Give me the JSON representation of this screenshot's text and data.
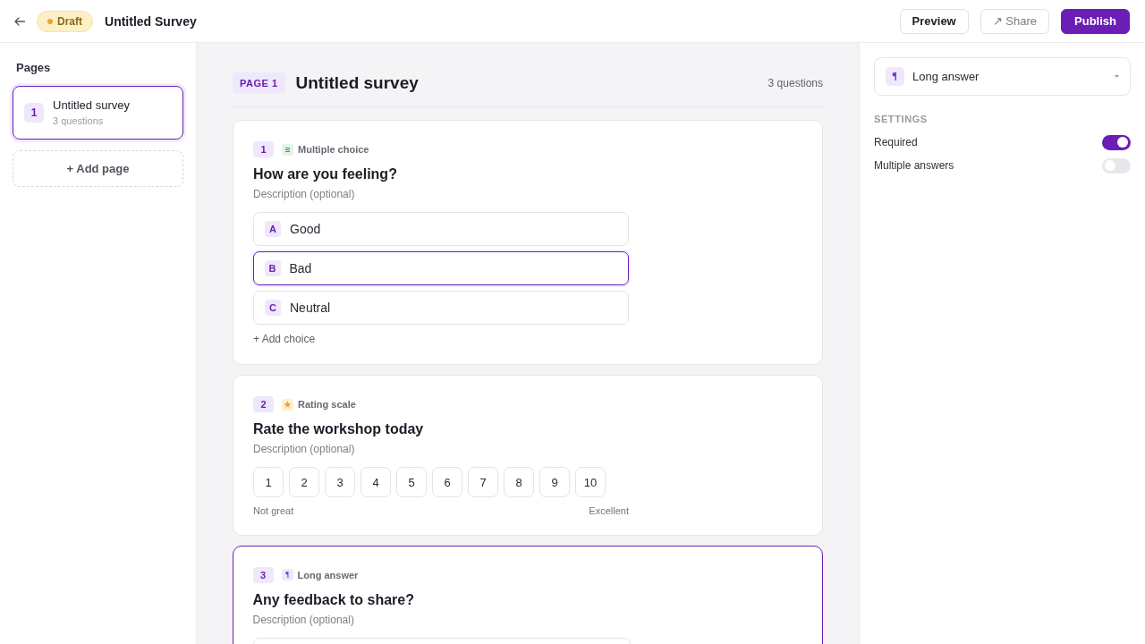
{
  "top_bar": {
    "status": "Draft",
    "title": "Untitled Survey",
    "buttons": [
      {
        "label": "Preview",
        "kind": "preview"
      },
      {
        "label": "↗ Share",
        "kind": "share"
      },
      {
        "label": "Publish",
        "kind": "publish"
      }
    ]
  },
  "sidebar": {
    "heading": "Pages",
    "pages": [
      {
        "number": "1",
        "title": "Untitled survey",
        "subtitle": "3 questions",
        "selected": true
      }
    ],
    "add_page": "+ Add page"
  },
  "editor": {
    "page_badge": "PAGE 1",
    "title": "Untitled survey",
    "question_count": "3 questions",
    "questions": [
      {
        "number": "1",
        "kind": "multiple_choice",
        "type_label": "Multiple choice",
        "title": "How are you feeling?",
        "description": {
          "placeholder": "Description (optional)"
        },
        "selected": false,
        "choices": [
          {
            "letter": "A",
            "label": "Good",
            "selected": false
          },
          {
            "letter": "B",
            "label": "Bad",
            "selected": true
          },
          {
            "letter": "C",
            "label": "Neutral",
            "selected": false
          }
        ],
        "add_choice": "+ Add choice"
      },
      {
        "number": "2",
        "kind": "rating",
        "type_label": "Rating scale",
        "title": "Rate the workshop today",
        "description": {
          "placeholder": "Description (optional)"
        },
        "selected": false,
        "scale": [
          "1",
          "2",
          "3",
          "4",
          "5",
          "6",
          "7",
          "8",
          "9",
          "10"
        ],
        "low_label": "Not great",
        "high_label": "Excellent"
      },
      {
        "number": "3",
        "kind": "long_answer",
        "type_label": "Long answer",
        "title": "Any feedback to share?",
        "description": {
          "placeholder": "Description (optional)"
        },
        "selected": true
      }
    ]
  },
  "settings_panel": {
    "type_select": {
      "kind": "long_answer",
      "value": "Long answer"
    },
    "heading": "SETTINGS",
    "settings": [
      {
        "label": "Required",
        "on": true
      },
      {
        "label": "Multiple answers",
        "on": false
      }
    ]
  }
}
